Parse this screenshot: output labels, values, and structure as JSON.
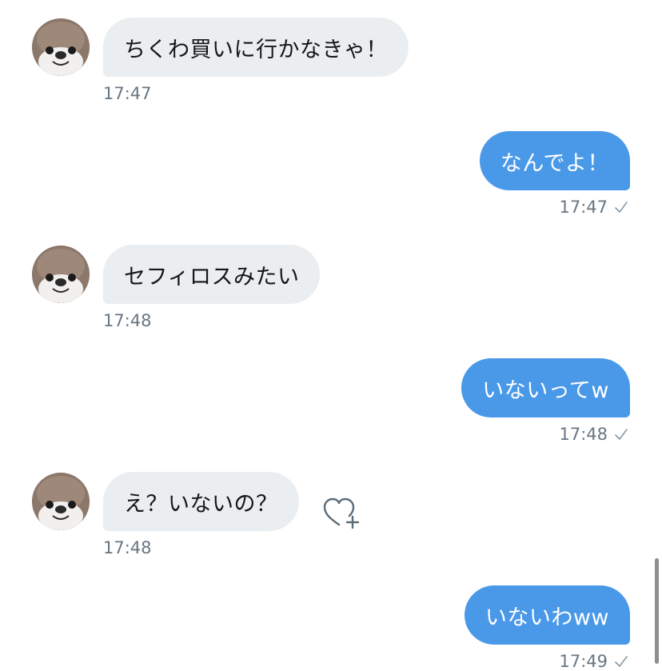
{
  "messages": [
    {
      "side": "in",
      "text": "ちくわ買いに行かなきゃ！",
      "time": "17:47",
      "avatar": "otter-avatar"
    },
    {
      "side": "out",
      "text": "なんでよ！",
      "time": "17:47",
      "status_icon": "check-icon"
    },
    {
      "side": "in",
      "text": "セフィロスみたい",
      "time": "17:48",
      "avatar": "otter-avatar"
    },
    {
      "side": "out",
      "text": "いないってw",
      "time": "17:48",
      "status_icon": "check-icon"
    },
    {
      "side": "in",
      "text": "え？いないの？",
      "time": "17:48",
      "avatar": "otter-avatar",
      "reaction_icon": "heart-plus-icon"
    },
    {
      "side": "out",
      "text": "いないわww",
      "time": "17:49",
      "status_icon": "check-icon"
    }
  ],
  "colors": {
    "incoming_bubble": "#ebeef0",
    "outgoing_bubble": "#4a99e9",
    "timestamp": "#687682"
  }
}
